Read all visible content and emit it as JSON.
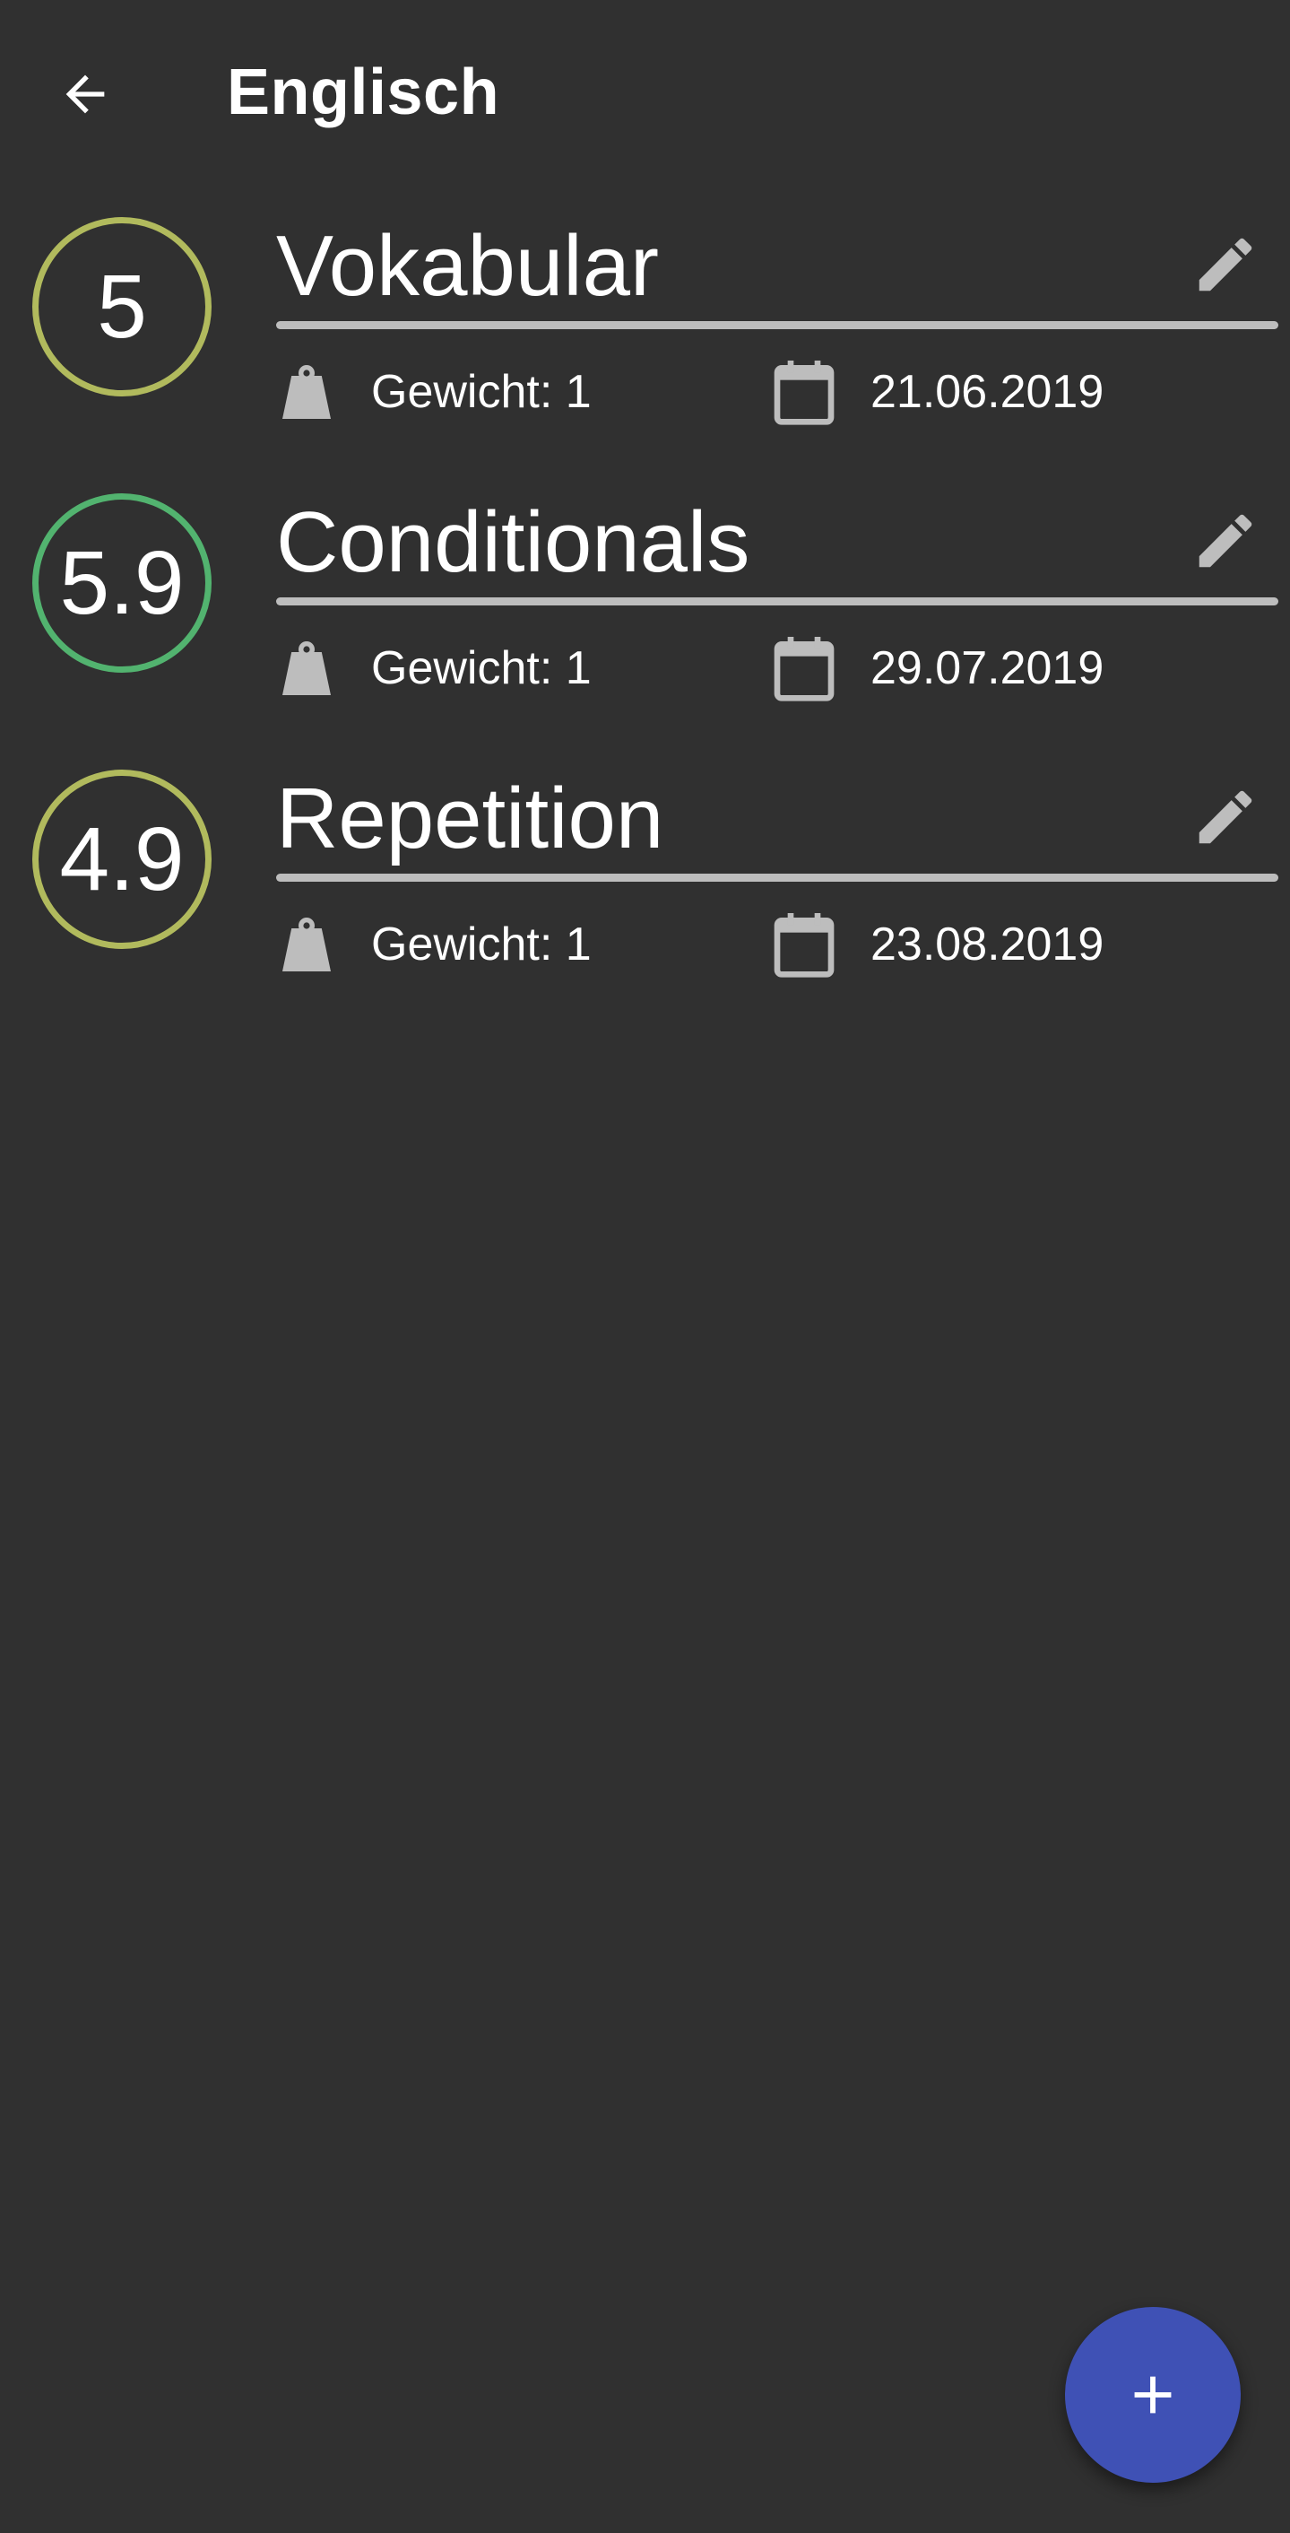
{
  "colors": {
    "background": "#303030",
    "grade_yellow": "#b1ba5d",
    "grade_green": "#52b36f",
    "underline": "#bdbdbd",
    "icon_grey": "#bdbdbd",
    "fab": "#3f51b5"
  },
  "toolbar": {
    "title": "Englisch",
    "back_icon": "arrow-back-icon"
  },
  "exams": [
    {
      "grade": "5",
      "grade_color": "#b1ba5d",
      "name": "Vokabular",
      "weight_label": "Gewicht: 1",
      "date": "21.06.2019"
    },
    {
      "grade": "5.9",
      "grade_color": "#52b36f",
      "name": "Conditionals",
      "weight_label": "Gewicht: 1",
      "date": "29.07.2019"
    },
    {
      "grade": "4.9",
      "grade_color": "#b1ba5d",
      "name": "Repetition",
      "weight_label": "Gewicht: 1",
      "date": "23.08.2019"
    }
  ],
  "icons": {
    "edit": "pencil-icon",
    "weight": "weight-icon",
    "date": "calendar-icon",
    "add": "plus-icon"
  }
}
